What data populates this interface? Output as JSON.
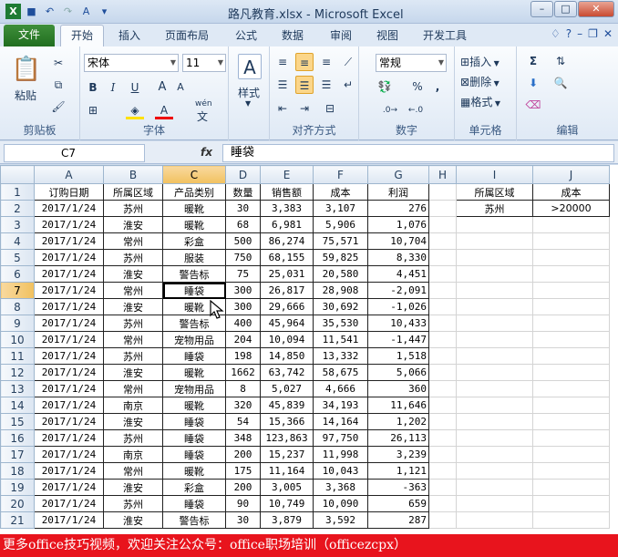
{
  "window": {
    "title": "路凡教育.xlsx - Microsoft Excel"
  },
  "tabs": {
    "file": "文件",
    "items": [
      "开始",
      "插入",
      "页面布局",
      "公式",
      "数据",
      "审阅",
      "视图",
      "开发工具"
    ]
  },
  "ribbon": {
    "clipboard": {
      "label": "剪贴板",
      "paste": "粘贴"
    },
    "font": {
      "label": "字体",
      "name": "宋体",
      "size": "11",
      "wen": "wén",
      "zi": "文"
    },
    "style": {
      "label": "样式"
    },
    "alignment": {
      "label": "对齐方式"
    },
    "number": {
      "label": "数字",
      "format": "常规",
      "percent": "%",
      "comma": ","
    },
    "cells": {
      "label": "单元格",
      "insert": "插入",
      "delete": "删除",
      "format": "格式"
    },
    "editing": {
      "label": "编辑"
    }
  },
  "formula_bar": {
    "name_box": "C7",
    "fx": "fx",
    "content": "睡袋"
  },
  "columns": [
    "A",
    "B",
    "C",
    "D",
    "E",
    "F",
    "G",
    "H",
    "I",
    "J"
  ],
  "selected_column": "C",
  "headers": [
    "订购日期",
    "所属区域",
    "产品类别",
    "数量",
    "销售额",
    "成本",
    "利润"
  ],
  "rows": [
    [
      "2017/1/24",
      "苏州",
      "暖靴",
      "30",
      "3,383",
      "3,107",
      "276"
    ],
    [
      "2017/1/24",
      "淮安",
      "暖靴",
      "68",
      "6,981",
      "5,906",
      "1,076"
    ],
    [
      "2017/1/24",
      "常州",
      "彩盒",
      "500",
      "86,274",
      "75,571",
      "10,704"
    ],
    [
      "2017/1/24",
      "苏州",
      "服装",
      "750",
      "68,155",
      "59,825",
      "8,330"
    ],
    [
      "2017/1/24",
      "淮安",
      "警告标",
      "75",
      "25,031",
      "20,580",
      "4,451"
    ],
    [
      "2017/1/24",
      "常州",
      "睡袋",
      "300",
      "26,817",
      "28,908",
      "-2,091"
    ],
    [
      "2017/1/24",
      "淮安",
      "暖靴",
      "300",
      "29,666",
      "30,692",
      "-1,026"
    ],
    [
      "2017/1/24",
      "苏州",
      "警告标",
      "400",
      "45,964",
      "35,530",
      "10,433"
    ],
    [
      "2017/1/24",
      "常州",
      "宠物用品",
      "204",
      "10,094",
      "11,541",
      "-1,447"
    ],
    [
      "2017/1/24",
      "苏州",
      "睡袋",
      "198",
      "14,850",
      "13,332",
      "1,518"
    ],
    [
      "2017/1/24",
      "淮安",
      "暖靴",
      "1662",
      "63,742",
      "58,675",
      "5,066"
    ],
    [
      "2017/1/24",
      "常州",
      "宠物用品",
      "8",
      "5,027",
      "4,666",
      "360"
    ],
    [
      "2017/1/24",
      "南京",
      "暖靴",
      "320",
      "45,839",
      "34,193",
      "11,646"
    ],
    [
      "2017/1/24",
      "淮安",
      "睡袋",
      "54",
      "15,366",
      "14,164",
      "1,202"
    ],
    [
      "2017/1/24",
      "苏州",
      "睡袋",
      "348",
      "123,863",
      "97,750",
      "26,113"
    ],
    [
      "2017/1/24",
      "南京",
      "睡袋",
      "200",
      "15,237",
      "11,998",
      "3,239"
    ],
    [
      "2017/1/24",
      "常州",
      "暖靴",
      "175",
      "11,164",
      "10,043",
      "1,121"
    ],
    [
      "2017/1/24",
      "淮安",
      "彩盒",
      "200",
      "3,005",
      "3,368",
      "-363"
    ],
    [
      "2017/1/24",
      "苏州",
      "睡袋",
      "90",
      "10,749",
      "10,090",
      "659"
    ],
    [
      "2017/1/24",
      "淮安",
      "警告标",
      "30",
      "3,879",
      "3,592",
      "287"
    ]
  ],
  "criteria": {
    "headers": [
      "所属区域",
      "成本"
    ],
    "values": [
      "苏州",
      ">20000"
    ]
  },
  "banner": "更多office技巧视频，欢迎关注公众号：office职场培训（officezcpx）"
}
